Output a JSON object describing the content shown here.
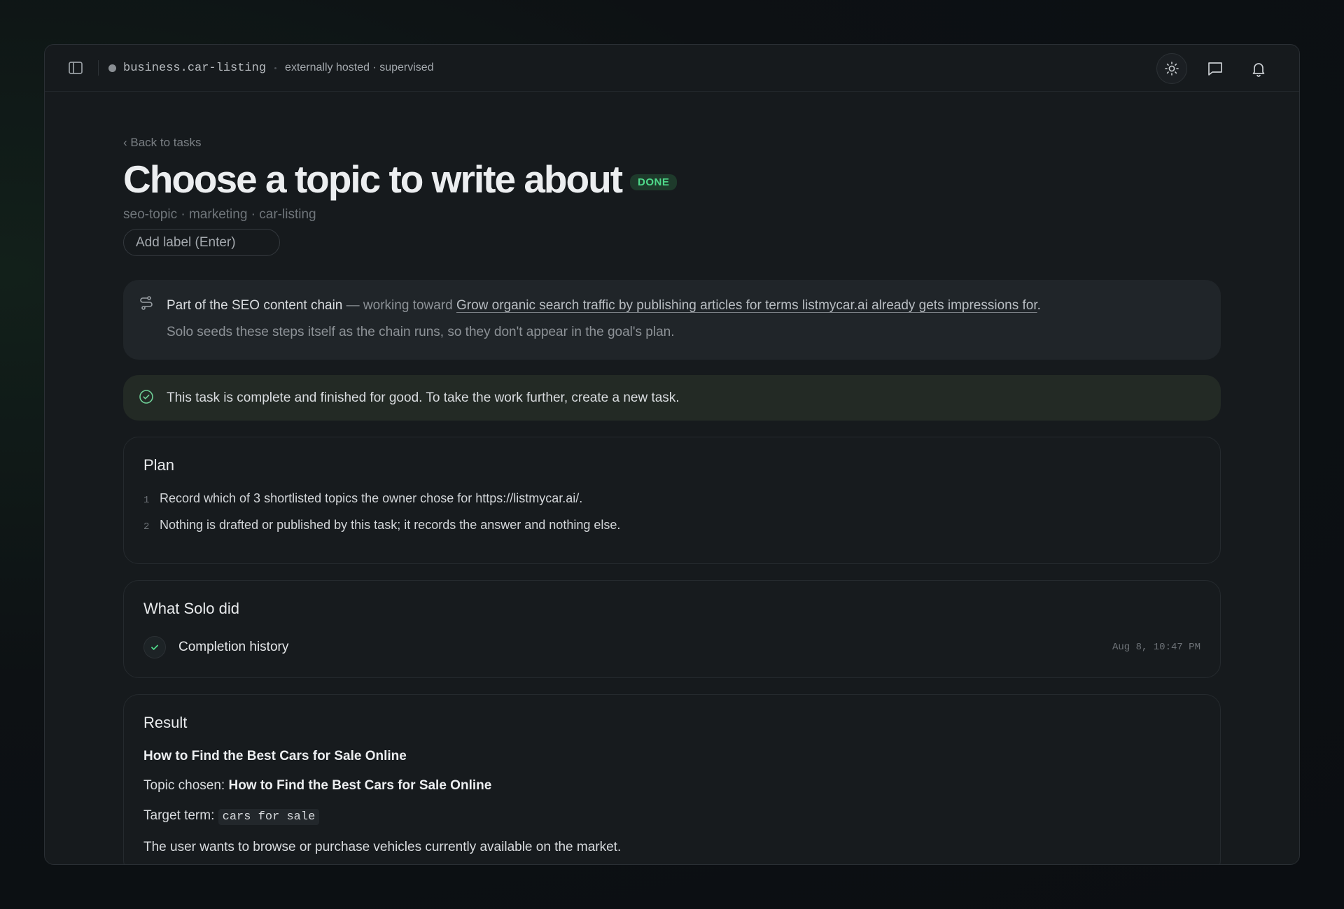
{
  "topbar": {
    "workspace": "business.car-listing",
    "hosting": "externally hosted · supervised"
  },
  "task": {
    "back_link": "‹ Back to tasks",
    "title": "Choose a topic to write about",
    "status": "DONE",
    "tags": "seo-topic · marketing · car-listing",
    "add_label_placeholder": "Add label (Enter)"
  },
  "chain": {
    "lead": "Part of the SEO content chain",
    "mid": " — working toward ",
    "goal_link": "Grow organic search traffic by publishing articles for terms listmycar.ai already gets impressions for",
    "period": ".",
    "note": "Solo seeds these steps itself as the chain runs, so they don't appear in the goal's plan."
  },
  "completion_notice": "This task is complete and finished for good. To take the work further, create a new task.",
  "plan": {
    "title": "Plan",
    "steps": [
      {
        "num": "1",
        "text": "Record which of 3 shortlisted topics the owner chose for https://listmycar.ai/."
      },
      {
        "num": "2",
        "text": "Nothing is drafted or published by this task; it records the answer and nothing else."
      }
    ]
  },
  "activity": {
    "title": "What Solo did",
    "entry_label": "Completion history",
    "entry_time": "Aug 8, 10:47 PM"
  },
  "result": {
    "title": "Result",
    "heading": "How to Find the Best Cars for Sale Online",
    "topic_prefix": "Topic chosen: ",
    "topic_value": "How to Find the Best Cars for Sale Online",
    "term_prefix": "Target term: ",
    "term_value": "cars for sale",
    "intent": "The user wants to browse or purchase vehicles currently available on the market."
  },
  "colors": {
    "accent_green": "#4fd98a",
    "background": "#161a1d"
  },
  "icons": [
    "sidebar-toggle-icon",
    "sun-icon",
    "chat-icon",
    "bell-icon",
    "chain-icon",
    "check-circle-icon",
    "check-icon"
  ]
}
